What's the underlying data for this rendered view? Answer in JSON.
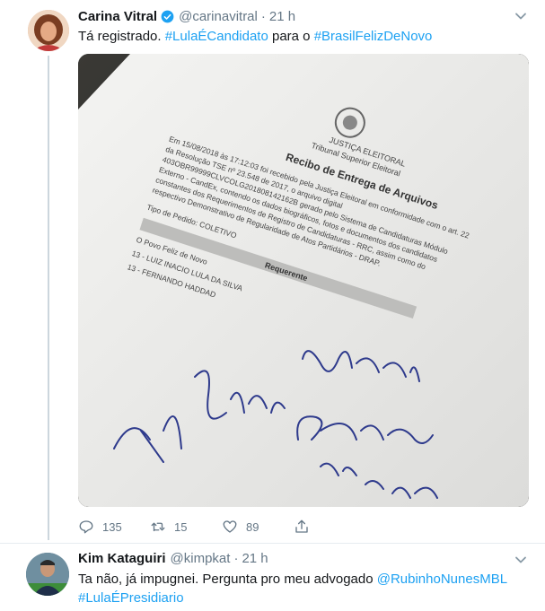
{
  "tweet1": {
    "name": "Carina Vitral",
    "handle": "@carinavitral",
    "separator": "·",
    "time": "21 h",
    "verified": true,
    "text_prefix": "Tá registrado. ",
    "hashtag1": "#LulaÉCandidato",
    "text_middle": " para o ",
    "hashtag2": "#BrasilFelizDeNovo",
    "counts": {
      "replies": "135",
      "retweets": "15",
      "likes": "89"
    },
    "photo": {
      "header_line1": "JUSTIÇA ELEITORAL",
      "header_line2": "Tribunal Superior Eleitoral",
      "title": "Recibo de Entrega de Arquivos",
      "paragraph": [
        "Em 15/08/2018 às 17:12:03 foi recebido pela Justiça Eleitoral em conformidade com o art. 22",
        "da Resolução TSE nº 23.548 de 2017, o arquivo digital",
        "403OBR99999CLVCOLG201808142162B gerado pelo Sistema de Candidaturas Módulo",
        "Externo - CandEx, contendo os dados biográficos, fotos e documentos dos candidatos",
        "constantes dos Requerimentos de Registro de Candidaturas - RRC, assim como do",
        "respectivo Demonstrativo de Regularidade de Atos Partidários - DRAP."
      ],
      "order_type": "Tipo de Pedido: COLETIVO",
      "section": "Requerente",
      "requester": "O Povo Feliz de Novo",
      "candidate1": "13 - LUIZ INACIO LULA DA SILVA",
      "candidate2": "13 - FERNANDO HADDAD"
    }
  },
  "tweet2": {
    "name": "Kim Kataguiri",
    "handle": "@kimpkat",
    "separator": "·",
    "time": "21 h",
    "text_prefix": "Ta não, já impugnei. Pergunta pro meu advogado ",
    "mention": "@RubinhoNunesMBL",
    "hashtag": "#LulaÉPresidiario"
  },
  "icons": {
    "verified": "verified-badge-icon",
    "caret": "chevron-down-icon",
    "reply": "reply-icon",
    "retweet": "retweet-icon",
    "like": "heart-icon",
    "share": "share-icon"
  },
  "colors": {
    "link": "#1da1f2",
    "muted": "#657786",
    "thread_line": "#ccd6dd"
  }
}
